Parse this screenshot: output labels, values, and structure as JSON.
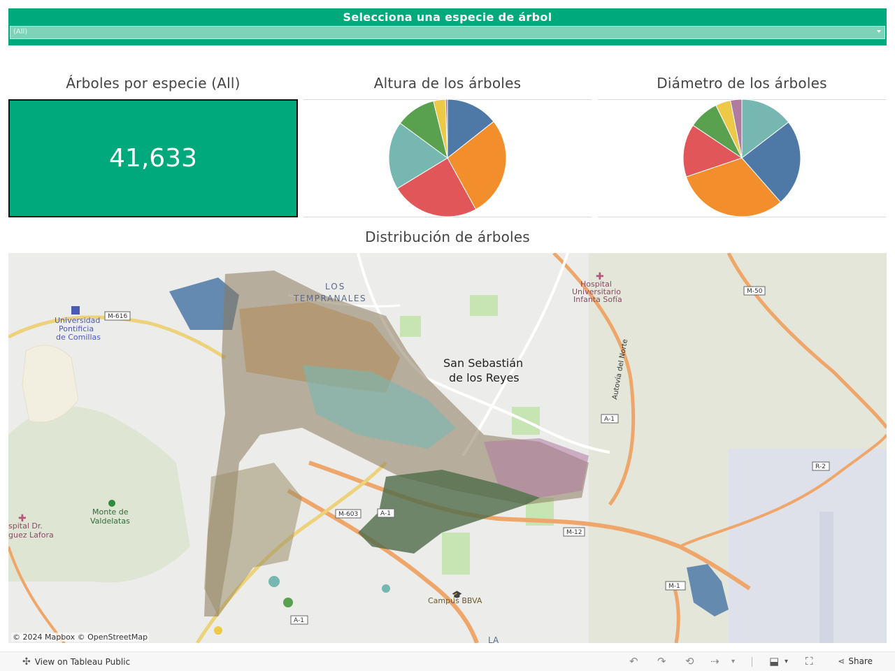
{
  "filter": {
    "title": "Selecciona una especie de árbol",
    "selected": "(All)"
  },
  "panels": {
    "kpi_title": "Árboles por especie (All)",
    "kpi_value": "41,633",
    "height_title": "Altura de los árboles",
    "diameter_title": "Diámetro de los árboles",
    "map_title": "Distribución de árboles"
  },
  "chart_data": [
    {
      "type": "pie",
      "title": "Altura de los árboles",
      "values": [
        13,
        25,
        22,
        17,
        10,
        3,
        0.5
      ],
      "colors": [
        "#4e79a7",
        "#f28e2b",
        "#e15759",
        "#76b7b2",
        "#59a14f",
        "#edc948",
        "#b07aa1"
      ]
    },
    {
      "type": "pie",
      "title": "Diámetro de los árboles",
      "values": [
        14,
        23,
        30,
        14,
        8,
        4,
        3
      ],
      "colors": [
        "#76b7b2",
        "#4e79a7",
        "#f28e2b",
        "#e15759",
        "#59a14f",
        "#edc948",
        "#b07aa1"
      ]
    }
  ],
  "map": {
    "labels": {
      "los_tempranales": "LOS TEMPRANALES",
      "san_sebastian": "San Sebastián",
      "de_los_reyes": "de los Reyes",
      "universidad_1": "Universidad",
      "universidad_2": "Pontificia",
      "universidad_3": "de Comillas",
      "hospital_1": "Hospital",
      "hospital_2": "Universitario",
      "hospital_3": "Infanta Sofía",
      "monte_1": "Monte de",
      "monte_2": "Valdelatas",
      "hospital_dr_1": "spital Dr.",
      "hospital_dr_2": "guez Lafora",
      "campus": "Campus BBVA",
      "autovia": "Autovía del Norte",
      "la": "LA"
    },
    "roads": [
      "M-616",
      "M-50",
      "A-1",
      "M-603",
      "M-12",
      "R-2",
      "M-1"
    ],
    "attribution": "© 2024 Mapbox  © OpenStreetMap"
  },
  "toolbar": {
    "view_on": "View on Tableau Public",
    "share": "Share"
  }
}
